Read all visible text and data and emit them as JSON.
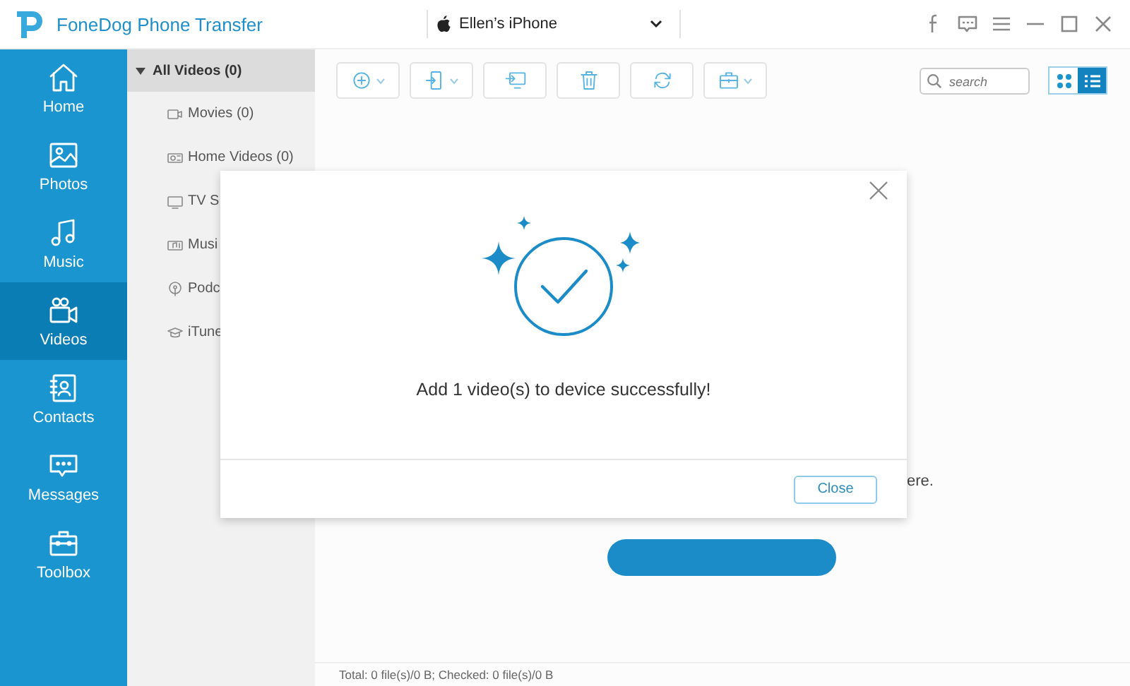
{
  "window": {
    "app_name": "FoneDog Phone Transfer",
    "device": "Ellen’s iPhone"
  },
  "nav": [
    {
      "label": "Home",
      "selected": false
    },
    {
      "label": "Photos",
      "selected": false
    },
    {
      "label": "Music",
      "selected": false
    },
    {
      "label": "Videos",
      "selected": true
    },
    {
      "label": "Contacts",
      "selected": false
    },
    {
      "label": "Messages",
      "selected": false
    },
    {
      "label": "Toolbox",
      "selected": false
    }
  ],
  "categories": {
    "header": "All Videos (0)",
    "expanded": true,
    "items": [
      {
        "label": "Movies (0)"
      },
      {
        "label": "Home Videos (0)"
      },
      {
        "label": "TV S"
      },
      {
        "label": "Musi"
      },
      {
        "label": "Podc"
      },
      {
        "label": "iTune"
      }
    ]
  },
  "toolbar": {
    "search": {
      "placeholder": "search"
    },
    "views": [
      {
        "kind": "grid",
        "selected": false
      },
      {
        "kind": "list",
        "selected": true
      }
    ]
  },
  "empty_hint": "ere.",
  "dialog": {
    "message": "Add 1 video(s) to device successfully!",
    "button": "Close"
  },
  "status_bar": "Total: 0 file(s)/0 B; Checked: 0 file(s)/0 B"
}
